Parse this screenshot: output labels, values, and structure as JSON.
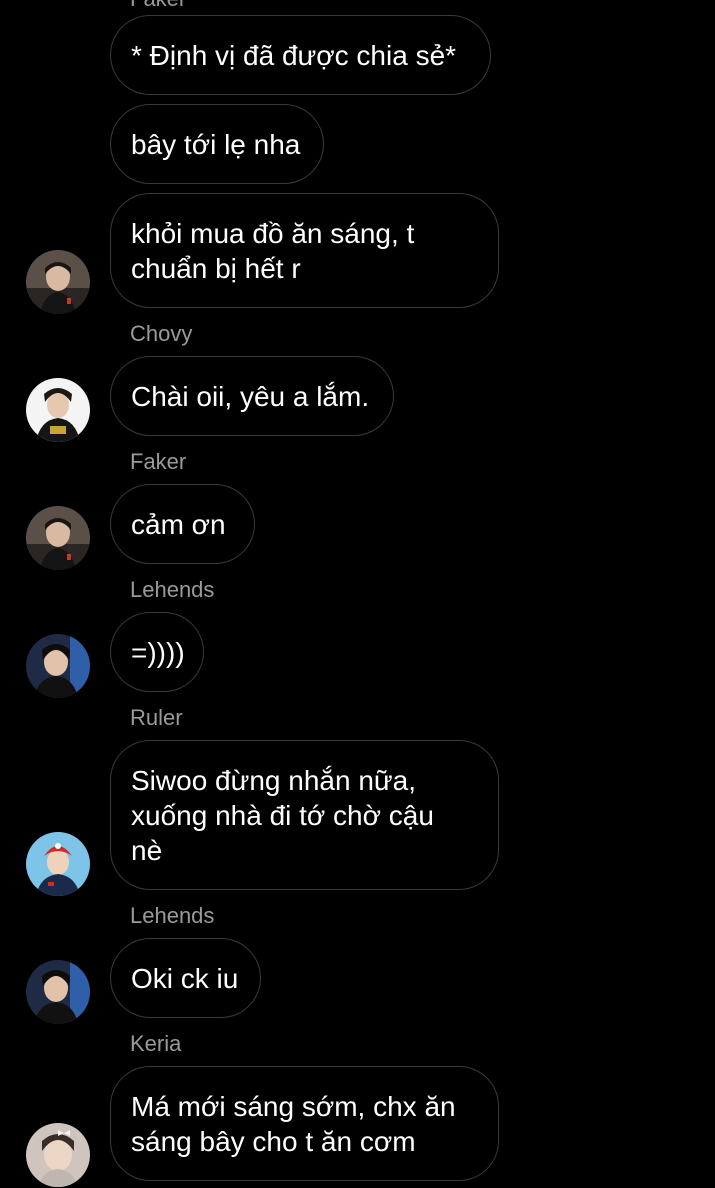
{
  "chat": {
    "top_sender": "Faker",
    "groups": [
      {
        "sender": "",
        "messages": [
          "* Định vị đã được chia sẻ*",
          "bây tới lẹ nha",
          "khỏi mua đồ ăn sáng, t\nchuẩn bị hết r"
        ],
        "avatar_icon": "faker-avatar-icon"
      },
      {
        "sender": "Chovy",
        "messages": [
          "Chài oii, yêu a lắm."
        ],
        "avatar_icon": "chovy-avatar-icon"
      },
      {
        "sender": "Faker",
        "messages": [
          "cảm ơn"
        ],
        "avatar_icon": "faker-avatar-icon"
      },
      {
        "sender": "Lehends",
        "messages": [
          "=))))"
        ],
        "avatar_icon": "lehends-avatar-icon"
      },
      {
        "sender": "Ruler",
        "messages": [
          "Siwoo đừng nhắn nữa,\nxuống nhà đi tớ  chờ cậu\nnè"
        ],
        "avatar_icon": "ruler-avatar-icon"
      },
      {
        "sender": "Lehends",
        "messages": [
          "Oki ck iu"
        ],
        "avatar_icon": "lehends-avatar-icon"
      },
      {
        "sender": "Keria",
        "messages": [
          "Má mới sáng sớm, chx ăn\nsáng bây cho t ăn cơm"
        ],
        "avatar_icon": "keria-avatar-icon"
      }
    ]
  }
}
